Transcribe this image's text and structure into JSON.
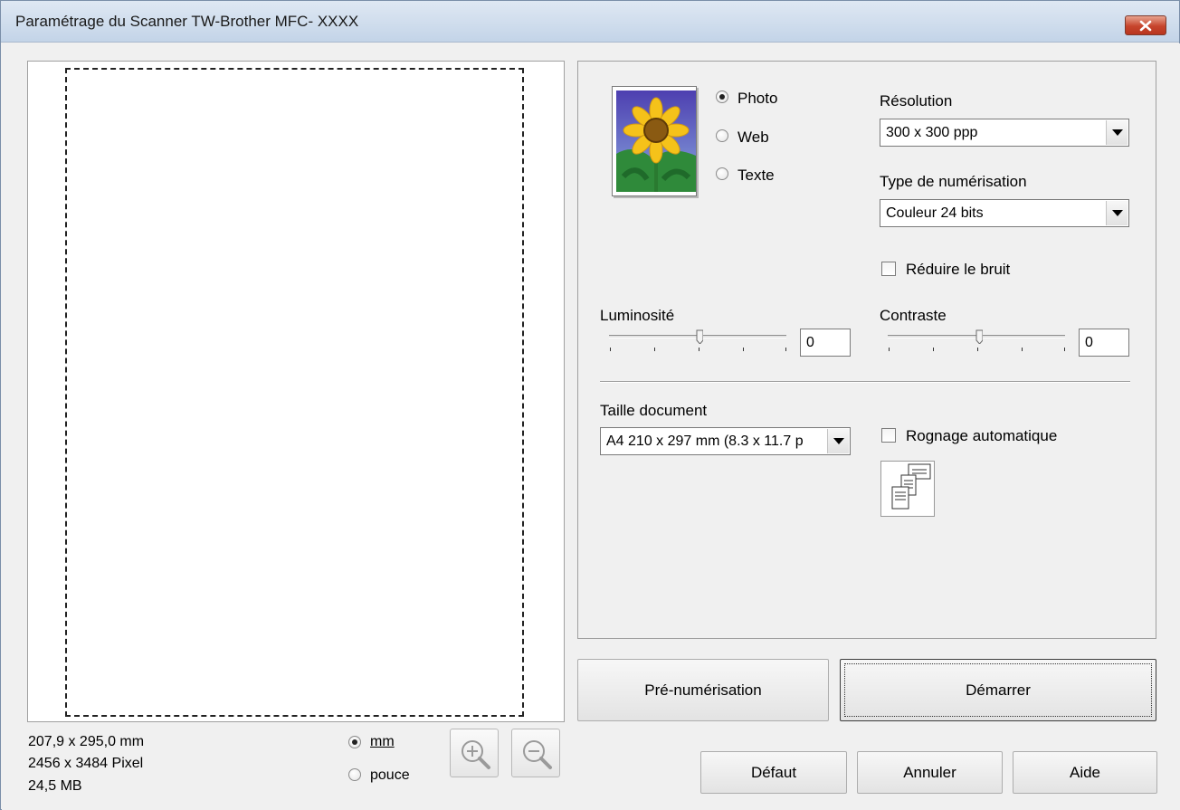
{
  "window": {
    "title": "Paramétrage du Scanner TW-Brother MFC- XXXX"
  },
  "preview": {
    "dimensions_mm": "207,9 x 295,0 mm",
    "dimensions_px": "2456 x 3484 Pixel",
    "file_size": "24,5 MB",
    "units": [
      {
        "label": "mm",
        "selected": true
      },
      {
        "label": "pouce",
        "selected": false
      }
    ]
  },
  "scan_mode": {
    "options": [
      {
        "label": "Photo",
        "selected": true
      },
      {
        "label": "Web",
        "selected": false
      },
      {
        "label": "Texte",
        "selected": false
      }
    ]
  },
  "resolution": {
    "label": "Résolution",
    "value": "300 x 300 ppp"
  },
  "scan_type": {
    "label": "Type de numérisation",
    "value": "Couleur 24 bits"
  },
  "noise": {
    "label": "Réduire le bruit",
    "checked": false
  },
  "brightness": {
    "label": "Luminosité",
    "value": "0"
  },
  "contrast": {
    "label": "Contraste",
    "value": "0"
  },
  "document_size": {
    "label": "Taille document",
    "value": "A4 210 x 297 mm (8.3 x 11.7 p"
  },
  "auto_crop": {
    "label": "Rognage automatique",
    "checked": false
  },
  "buttons": {
    "prescan": "Pré-numérisation",
    "start": "Démarrer",
    "default": "Défaut",
    "cancel": "Annuler",
    "help": "Aide"
  },
  "colors": {
    "titlebar": "#c3d4e8",
    "close": "#c6442c",
    "background": "#f0f0f0"
  }
}
